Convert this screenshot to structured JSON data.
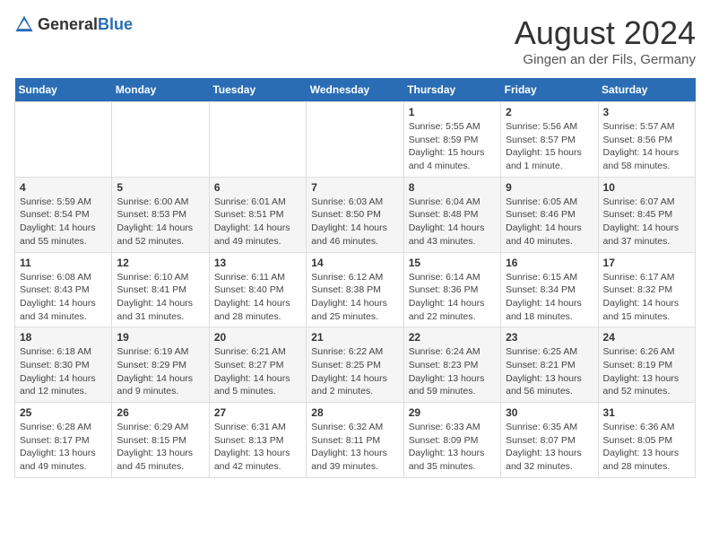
{
  "header": {
    "logo_general": "General",
    "logo_blue": "Blue",
    "title": "August 2024",
    "subtitle": "Gingen an der Fils, Germany"
  },
  "weekdays": [
    "Sunday",
    "Monday",
    "Tuesday",
    "Wednesday",
    "Thursday",
    "Friday",
    "Saturday"
  ],
  "weeks": [
    [
      {
        "day": "",
        "info": ""
      },
      {
        "day": "",
        "info": ""
      },
      {
        "day": "",
        "info": ""
      },
      {
        "day": "",
        "info": ""
      },
      {
        "day": "1",
        "info": "Sunrise: 5:55 AM\nSunset: 8:59 PM\nDaylight: 15 hours\nand 4 minutes."
      },
      {
        "day": "2",
        "info": "Sunrise: 5:56 AM\nSunset: 8:57 PM\nDaylight: 15 hours\nand 1 minute."
      },
      {
        "day": "3",
        "info": "Sunrise: 5:57 AM\nSunset: 8:56 PM\nDaylight: 14 hours\nand 58 minutes."
      }
    ],
    [
      {
        "day": "4",
        "info": "Sunrise: 5:59 AM\nSunset: 8:54 PM\nDaylight: 14 hours\nand 55 minutes."
      },
      {
        "day": "5",
        "info": "Sunrise: 6:00 AM\nSunset: 8:53 PM\nDaylight: 14 hours\nand 52 minutes."
      },
      {
        "day": "6",
        "info": "Sunrise: 6:01 AM\nSunset: 8:51 PM\nDaylight: 14 hours\nand 49 minutes."
      },
      {
        "day": "7",
        "info": "Sunrise: 6:03 AM\nSunset: 8:50 PM\nDaylight: 14 hours\nand 46 minutes."
      },
      {
        "day": "8",
        "info": "Sunrise: 6:04 AM\nSunset: 8:48 PM\nDaylight: 14 hours\nand 43 minutes."
      },
      {
        "day": "9",
        "info": "Sunrise: 6:05 AM\nSunset: 8:46 PM\nDaylight: 14 hours\nand 40 minutes."
      },
      {
        "day": "10",
        "info": "Sunrise: 6:07 AM\nSunset: 8:45 PM\nDaylight: 14 hours\nand 37 minutes."
      }
    ],
    [
      {
        "day": "11",
        "info": "Sunrise: 6:08 AM\nSunset: 8:43 PM\nDaylight: 14 hours\nand 34 minutes."
      },
      {
        "day": "12",
        "info": "Sunrise: 6:10 AM\nSunset: 8:41 PM\nDaylight: 14 hours\nand 31 minutes."
      },
      {
        "day": "13",
        "info": "Sunrise: 6:11 AM\nSunset: 8:40 PM\nDaylight: 14 hours\nand 28 minutes."
      },
      {
        "day": "14",
        "info": "Sunrise: 6:12 AM\nSunset: 8:38 PM\nDaylight: 14 hours\nand 25 minutes."
      },
      {
        "day": "15",
        "info": "Sunrise: 6:14 AM\nSunset: 8:36 PM\nDaylight: 14 hours\nand 22 minutes."
      },
      {
        "day": "16",
        "info": "Sunrise: 6:15 AM\nSunset: 8:34 PM\nDaylight: 14 hours\nand 18 minutes."
      },
      {
        "day": "17",
        "info": "Sunrise: 6:17 AM\nSunset: 8:32 PM\nDaylight: 14 hours\nand 15 minutes."
      }
    ],
    [
      {
        "day": "18",
        "info": "Sunrise: 6:18 AM\nSunset: 8:30 PM\nDaylight: 14 hours\nand 12 minutes."
      },
      {
        "day": "19",
        "info": "Sunrise: 6:19 AM\nSunset: 8:29 PM\nDaylight: 14 hours\nand 9 minutes."
      },
      {
        "day": "20",
        "info": "Sunrise: 6:21 AM\nSunset: 8:27 PM\nDaylight: 14 hours\nand 5 minutes."
      },
      {
        "day": "21",
        "info": "Sunrise: 6:22 AM\nSunset: 8:25 PM\nDaylight: 14 hours\nand 2 minutes."
      },
      {
        "day": "22",
        "info": "Sunrise: 6:24 AM\nSunset: 8:23 PM\nDaylight: 13 hours\nand 59 minutes."
      },
      {
        "day": "23",
        "info": "Sunrise: 6:25 AM\nSunset: 8:21 PM\nDaylight: 13 hours\nand 56 minutes."
      },
      {
        "day": "24",
        "info": "Sunrise: 6:26 AM\nSunset: 8:19 PM\nDaylight: 13 hours\nand 52 minutes."
      }
    ],
    [
      {
        "day": "25",
        "info": "Sunrise: 6:28 AM\nSunset: 8:17 PM\nDaylight: 13 hours\nand 49 minutes."
      },
      {
        "day": "26",
        "info": "Sunrise: 6:29 AM\nSunset: 8:15 PM\nDaylight: 13 hours\nand 45 minutes."
      },
      {
        "day": "27",
        "info": "Sunrise: 6:31 AM\nSunset: 8:13 PM\nDaylight: 13 hours\nand 42 minutes."
      },
      {
        "day": "28",
        "info": "Sunrise: 6:32 AM\nSunset: 8:11 PM\nDaylight: 13 hours\nand 39 minutes."
      },
      {
        "day": "29",
        "info": "Sunrise: 6:33 AM\nSunset: 8:09 PM\nDaylight: 13 hours\nand 35 minutes."
      },
      {
        "day": "30",
        "info": "Sunrise: 6:35 AM\nSunset: 8:07 PM\nDaylight: 13 hours\nand 32 minutes."
      },
      {
        "day": "31",
        "info": "Sunrise: 6:36 AM\nSunset: 8:05 PM\nDaylight: 13 hours\nand 28 minutes."
      }
    ]
  ]
}
